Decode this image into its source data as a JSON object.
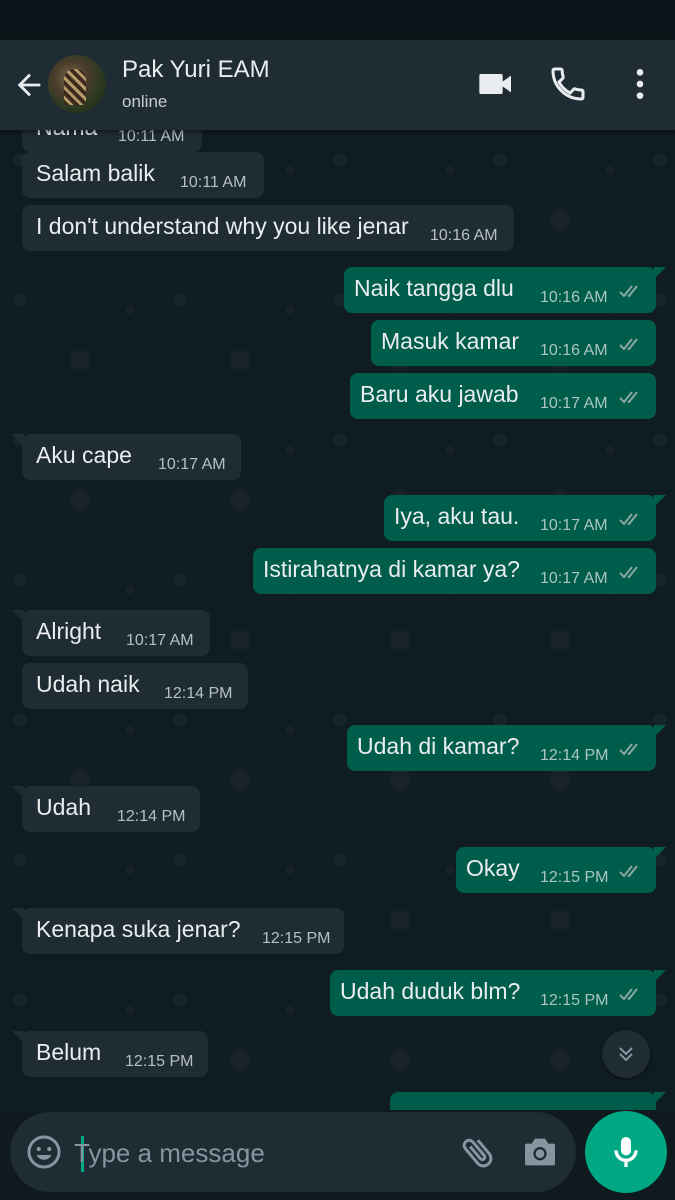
{
  "header": {
    "contact_name": "Pak Yuri EAM",
    "status": "online",
    "icons": [
      "back-arrow-icon",
      "avatar",
      "video-call-icon",
      "voice-call-icon",
      "more-options-icon"
    ]
  },
  "messages": [
    {
      "direction": "in",
      "text": "Nama",
      "time": "10:11 AM"
    },
    {
      "direction": "in",
      "text": "Salam balik",
      "time": "10:11 AM"
    },
    {
      "direction": "in",
      "text": "I don't understand why you like jenar",
      "time": "10:16 AM"
    },
    {
      "direction": "out",
      "text": "Naik tangga dlu",
      "time": "10:16 AM",
      "read": true
    },
    {
      "direction": "out",
      "text": "Masuk kamar",
      "time": "10:16 AM",
      "read": true
    },
    {
      "direction": "out",
      "text": "Baru aku jawab",
      "time": "10:17 AM",
      "read": true
    },
    {
      "direction": "in",
      "text": "Aku cape",
      "time": "10:17 AM"
    },
    {
      "direction": "out",
      "text": "Iya, aku tau.",
      "time": "10:17 AM",
      "read": true
    },
    {
      "direction": "out",
      "text": "Istirahatnya di kamar ya?",
      "time": "10:17 AM",
      "read": true
    },
    {
      "direction": "in",
      "text": "Alright",
      "time": "10:17 AM"
    },
    {
      "direction": "in",
      "text": "Udah naik",
      "time": "12:14 PM"
    },
    {
      "direction": "out",
      "text": "Udah di kamar?",
      "time": "12:14 PM",
      "read": true
    },
    {
      "direction": "in",
      "text": "Udah",
      "time": "12:14 PM"
    },
    {
      "direction": "out",
      "text": "Okay",
      "time": "12:15 PM",
      "read": true
    },
    {
      "direction": "in",
      "text": "Kenapa suka jenar?",
      "time": "12:15 PM"
    },
    {
      "direction": "out",
      "text": "Udah duduk blm?",
      "time": "12:15 PM",
      "read": true
    },
    {
      "direction": "in",
      "text": "Belum",
      "time": "12:15 PM"
    }
  ],
  "composer": {
    "placeholder": "Type a message",
    "value": ""
  },
  "colors": {
    "header_bg": "#1f2c33",
    "incoming_bubble": "#1f2c33",
    "outgoing_bubble": "#005c4b",
    "accent": "#00a884",
    "read_ticks": "#8aa7a0"
  }
}
